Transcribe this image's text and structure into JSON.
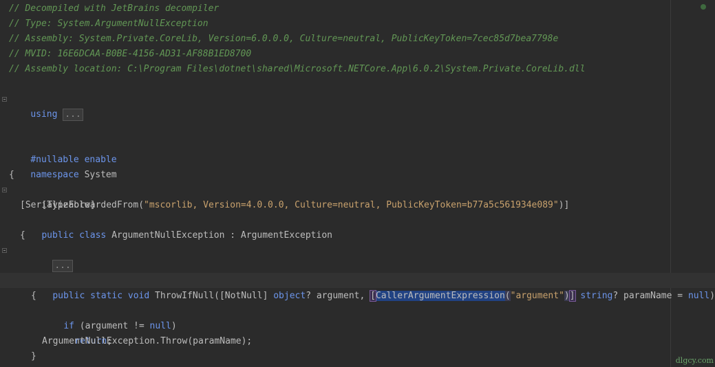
{
  "header_comments": [
    "// Decompiled with JetBrains decompiler",
    "// Type: System.ArgumentNullException",
    "// Assembly: System.Private.CoreLib, Version=6.0.0.0, Culture=neutral, PublicKeyToken=7cec85d7bea7798e",
    "// MVID: 16E6DCAA-B0BE-4156-AD31-AF88B1ED8700",
    "// Assembly location: C:\\Program Files\\dotnet\\shared\\Microsoft.NETCore.App\\6.0.2\\System.Private.CoreLib.dll"
  ],
  "using_line": {
    "keyword": "using",
    "collapsed": "..."
  },
  "nullable_line": {
    "directive": "#nullable",
    "value": "enable"
  },
  "namespace_line": {
    "keyword": "namespace",
    "name": "System"
  },
  "open_brace": "{",
  "attr_forwarded": {
    "open": "[TypeForwardedFrom(",
    "arg": "\"mscorlib, Version=4.0.0.0, Culture=neutral, PublicKeyToken=b77a5c561934e089\"",
    "close": ")]"
  },
  "attr_serializable": "[Serializable]",
  "class_line": {
    "kw1": "public",
    "kw2": "class",
    "name": "ArgumentNullException : ArgumentException"
  },
  "class_open_brace": "{",
  "class_collapsed": "...",
  "method_line": {
    "kw1": "public",
    "kw2": "static",
    "kw3": "void",
    "name_open": "ThrowIfNull([NotNull] ",
    "kw_object": "object",
    "arg1": "? argument, ",
    "attr_open_bracket": "[",
    "attr_name": "CallerArgumentExpression",
    "attr_open_paren": "(",
    "attr_arg": "\"argument\"",
    "attr_close_paren": ")",
    "attr_close_bracket": "]",
    "space": " ",
    "kw_string": "string",
    "arg2": "? paramName = ",
    "kw_null": "null",
    "close": ")"
  },
  "method_open_brace": "{",
  "if_line": {
    "kw_if": "if",
    "cond_open": " (argument != ",
    "kw_null": "null",
    "cond_close": ")"
  },
  "return_line": {
    "kw": "return",
    "end": ";"
  },
  "throw_line": "ArgumentNullException.Throw(paramName);",
  "method_close_brace": "}",
  "watermark": "dlgcy.com",
  "colors": {
    "background": "#2b2b2b",
    "comment": "#629755",
    "keyword": "#6c95eb",
    "string": "#c9a26d",
    "text": "#bdbdbd",
    "selection": "#214283"
  }
}
